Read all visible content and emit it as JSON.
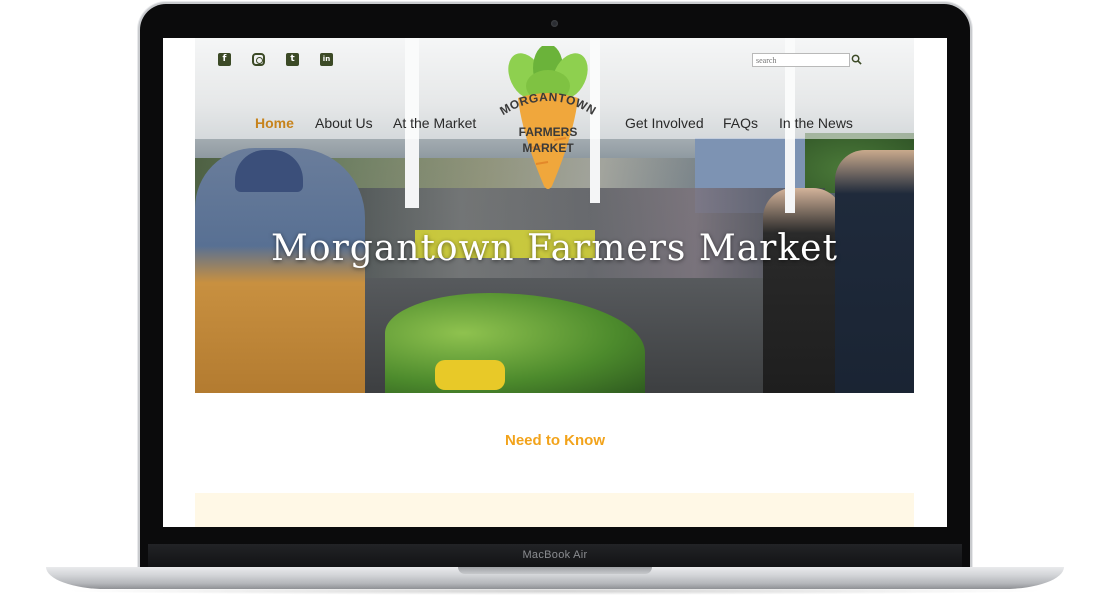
{
  "device": {
    "model_label": "MacBook Air"
  },
  "site": {
    "social": [
      {
        "name": "facebook",
        "glyph": "f"
      },
      {
        "name": "instagram",
        "glyph": ""
      },
      {
        "name": "twitter",
        "glyph": "t"
      },
      {
        "name": "linkedin",
        "glyph": "in"
      }
    ],
    "search": {
      "placeholder": "search"
    },
    "logo": {
      "line1": "MORGANTOWN",
      "line2": "FARMERS",
      "line3": "MARKET"
    },
    "nav": {
      "home": "Home",
      "about": "About Us",
      "market": "At the Market",
      "involved": "Get Involved",
      "faqs": "FAQs",
      "news": "In the News"
    },
    "hero_title": "Morgantown Farmers Market",
    "section_heading": "Need to Know"
  },
  "colors": {
    "accent_orange": "#f2a31b",
    "nav_active": "#c7831c",
    "icon_green": "#3c4a26",
    "carrot": "#f0a73c",
    "leaf": "#7fc242"
  }
}
